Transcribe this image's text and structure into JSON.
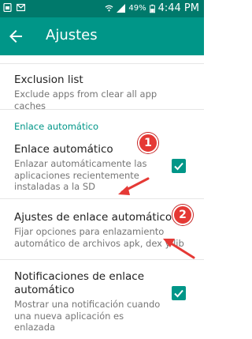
{
  "status_bar": {
    "battery": "49%",
    "time": "4:44 PM",
    "icons": [
      "sim-icon",
      "message-icon",
      "wifi-icon",
      "signal-icon",
      "battery-icon"
    ]
  },
  "app_bar": {
    "title": "Ajustes",
    "background": "#009688"
  },
  "settings": {
    "exclusion": {
      "title": "Exclusion list",
      "summary": "Exclude apps from clear all app caches"
    },
    "section_header": "Enlace automático",
    "auto_link": {
      "title": "Enlace automático",
      "summary": "Enlazar automáticamente las aplicaciones recientemente instaladas a la SD",
      "checked": true
    },
    "auto_link_settings": {
      "title": "Ajustes de enlace automático",
      "summary": "Fijar opciones para enlazamiento automático de archivos apk, dex y lib"
    },
    "notifications": {
      "title": "Notificaciones de enlace automático",
      "summary": "Mostrar una notificación cuando una nueva aplicación es enlazada",
      "checked": true
    }
  },
  "annotations": {
    "badge_1": "1",
    "badge_2": "2",
    "color": "#e53935"
  }
}
